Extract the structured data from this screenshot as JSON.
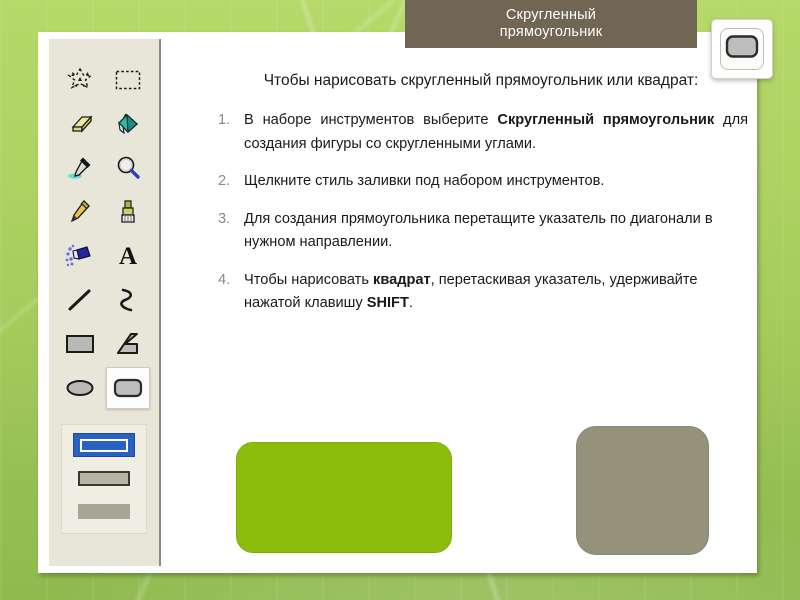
{
  "slide": {
    "background_color": "#a4cb5c",
    "panel_color": "#ffffff"
  },
  "title_banner": {
    "color": "#706653",
    "text_color": "#ffffff",
    "line1": "Скругленный",
    "line2": "прямоугольник"
  },
  "tool_badge": {
    "icon": "rounded-rectangle-tool-icon"
  },
  "toolbox": {
    "background_color": "#e8e6d9",
    "tools": [
      {
        "name": "free-form-select-tool",
        "icon": "free-form-select-icon"
      },
      {
        "name": "rectangular-select-tool",
        "icon": "rectangular-select-icon"
      },
      {
        "name": "eraser-tool",
        "icon": "eraser-icon"
      },
      {
        "name": "fill-with-color-tool",
        "icon": "paint-bucket-icon"
      },
      {
        "name": "pick-color-tool",
        "icon": "eyedropper-icon"
      },
      {
        "name": "magnifier-tool",
        "icon": "magnifier-icon"
      },
      {
        "name": "pencil-tool",
        "icon": "pencil-icon"
      },
      {
        "name": "brush-tool",
        "icon": "brush-icon"
      },
      {
        "name": "airbrush-tool",
        "icon": "airbrush-icon"
      },
      {
        "name": "text-tool",
        "icon": "text-a-icon",
        "glyph": "A"
      },
      {
        "name": "line-tool",
        "icon": "line-icon"
      },
      {
        "name": "curve-tool",
        "icon": "curve-icon"
      },
      {
        "name": "rectangle-tool",
        "icon": "rectangle-icon"
      },
      {
        "name": "polygon-tool",
        "icon": "polygon-icon"
      },
      {
        "name": "ellipse-tool",
        "icon": "ellipse-icon"
      },
      {
        "name": "rounded-rectangle-tool",
        "icon": "rounded-rectangle-icon",
        "selected": true
      }
    ],
    "fill_styles": [
      {
        "name": "outline-only",
        "selected": true
      },
      {
        "name": "outline-with-fill",
        "selected": false
      },
      {
        "name": "solid-fill",
        "selected": false
      }
    ]
  },
  "instructions": {
    "heading": "Чтобы нарисовать скругленный прямоугольник или квадрат:",
    "steps": [
      {
        "number": "1.",
        "parts": [
          {
            "t": "В наборе инструментов выберите ",
            "b": false
          },
          {
            "t": "Скругленный прямоугольник",
            "b": true
          },
          {
            "t": " для создания фигуры со скругленными углами.",
            "b": false
          }
        ],
        "justify": true
      },
      {
        "number": "2.",
        "parts": [
          {
            "t": "Щелкните стиль заливки под набором инструментов.",
            "b": false
          }
        ],
        "justify": false
      },
      {
        "number": "3.",
        "parts": [
          {
            "t": "Для создания прямоугольника перетащите указатель по диагонали в нужном направлении.",
            "b": false
          }
        ],
        "justify": false
      },
      {
        "number": "4.",
        "parts": [
          {
            "t": "Чтобы нарисовать ",
            "b": false
          },
          {
            "t": "квадрат",
            "b": true
          },
          {
            "t": ", перетаскивая указатель, удерживайте нажатой клавишу ",
            "b": false
          },
          {
            "t": "SHIFT",
            "b": true
          },
          {
            "t": ".",
            "b": false
          }
        ],
        "justify": false
      }
    ]
  },
  "example_shapes": [
    {
      "name": "rounded-rectangle-example",
      "fill": "#8cbd0b",
      "shape": "rounded-rectangle"
    },
    {
      "name": "rounded-square-example",
      "fill": "#94927a",
      "shape": "rounded-square"
    }
  ]
}
